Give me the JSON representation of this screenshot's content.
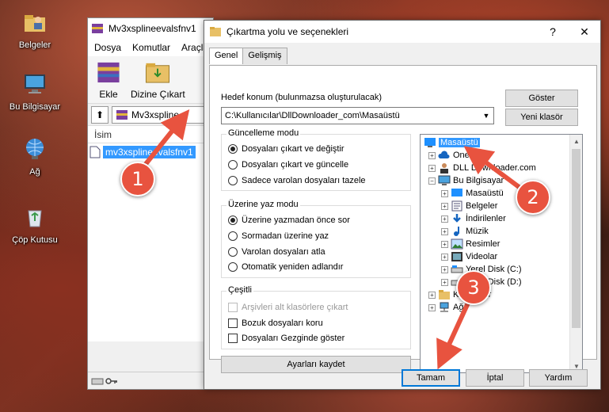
{
  "desktop": {
    "icons": [
      {
        "label": "Belgeler",
        "icon": "folder-user-icon"
      },
      {
        "label": "Bu Bilgisayar",
        "icon": "computer-icon"
      },
      {
        "label": "Ağ",
        "icon": "network-icon"
      },
      {
        "label": "Çöp Kutusu",
        "icon": "recycle-bin-icon"
      }
    ]
  },
  "winrar": {
    "title": "Mv3xsplineevalsfnv1",
    "menu": [
      "Dosya",
      "Komutlar",
      "Araçla"
    ],
    "toolbar": {
      "add_label": "Ekle",
      "extract_label": "Dizine Çıkart"
    },
    "address": "Mv3xspline",
    "column_name": "İsim",
    "file_name": "mv3xsplineevalsfnv1"
  },
  "dialog": {
    "title": "Çıkartma yolu ve seçenekleri",
    "tabs": [
      "Genel",
      "Gelişmiş"
    ],
    "dest_label": "Hedef konum (bulunmazsa oluşturulacak)",
    "dest_value": "C:\\Kullanıcılar\\DllDownloader_com\\Masaüstü",
    "show_button": "Göster",
    "new_folder_button": "Yeni klasör",
    "update_mode": {
      "title": "Güncelleme modu",
      "options": [
        "Dosyaları çıkart ve değiştir",
        "Dosyaları çıkart ve güncelle",
        "Sadece varolan dosyaları tazele"
      ],
      "selected": 0
    },
    "overwrite_mode": {
      "title": "Üzerine yaz modu",
      "options": [
        "Üzerine yazmadan önce sor",
        "Sormadan üzerine yaz",
        "Varolan dosyaları atla",
        "Otomatik yeniden adlandır"
      ],
      "selected": 0
    },
    "misc": {
      "title": "Çeşitli",
      "options": [
        "Arşivleri alt klasörlere çıkart",
        "Bozuk dosyaları koru",
        "Dosyaları Gezginde göster"
      ],
      "disabled": [
        true,
        false,
        false
      ]
    },
    "save_button": "Ayarları kaydet",
    "tree": [
      {
        "label": "Masaüstü",
        "selected": true
      },
      {
        "label": "OneDrive"
      },
      {
        "label": "DLL Downloader.com"
      },
      {
        "label": "Bu Bilgisayar"
      },
      {
        "label": "Masaüstü"
      },
      {
        "label": "Belgeler"
      },
      {
        "label": "İndirilenler"
      },
      {
        "label": "Müzik"
      },
      {
        "label": "Resimler"
      },
      {
        "label": "Videolar"
      },
      {
        "label": "Yerel Disk (C:)"
      },
      {
        "label": "Yerel Disk (D:)"
      },
      {
        "label": "Kitaplıklar"
      },
      {
        "label": "Ağ"
      }
    ],
    "ok_button": "Tamam",
    "cancel_button": "İptal",
    "help_button": "Yardım"
  },
  "callouts": [
    "1",
    "2",
    "3"
  ],
  "colors": {
    "callout": "#e8533f",
    "selection": "#3399ff",
    "focus": "#0078d7"
  }
}
